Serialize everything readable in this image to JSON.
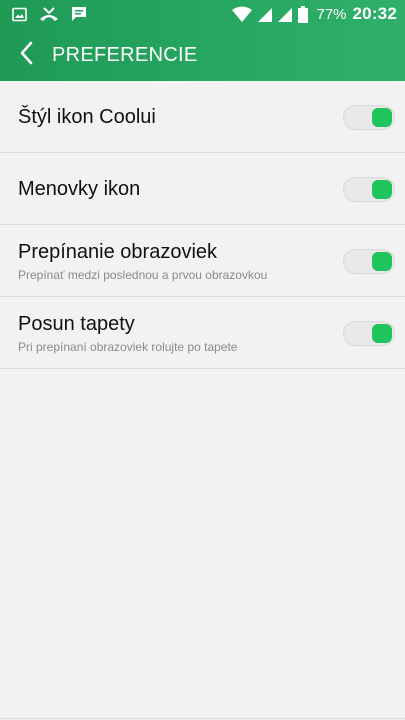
{
  "status_bar": {
    "left_icons": [
      "image-icon",
      "missed-call-icon",
      "message-icon"
    ],
    "right_icons": [
      "wifi-icon",
      "signal-icon",
      "signal-icon-2",
      "battery-icon"
    ],
    "battery_percent": "77%",
    "time": "20:32"
  },
  "app_bar": {
    "title": "PREFERENCIE",
    "back_icon": "chevron-left-icon"
  },
  "settings": [
    {
      "title": "Štýl ikon Coolui",
      "subtitle": "",
      "enabled": true
    },
    {
      "title": "Menovky ikon",
      "subtitle": "",
      "enabled": true
    },
    {
      "title": "Prepínanie obrazoviek",
      "subtitle": "Prepínať medzi poslednou a prvou obrazovkou",
      "enabled": true
    },
    {
      "title": "Posun tapety",
      "subtitle": "Pri prepínaní obrazoviek rolujte po tapete",
      "enabled": true
    }
  ],
  "colors": {
    "header": "#27a863",
    "toggle_on": "#1ec45c",
    "background": "#f2f2f2"
  }
}
